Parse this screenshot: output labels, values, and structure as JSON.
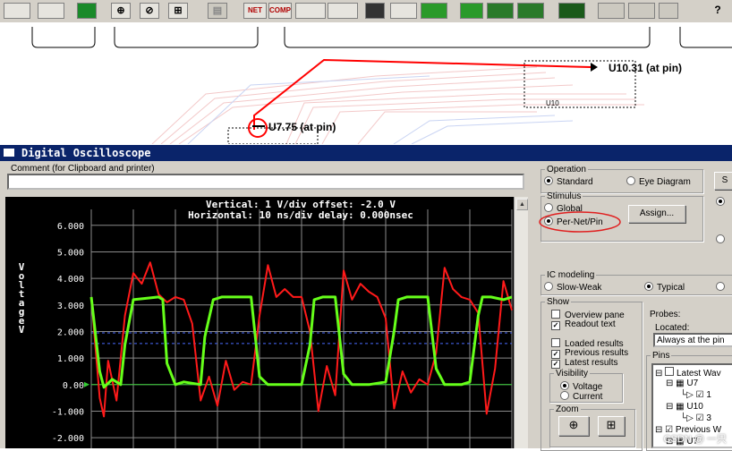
{
  "colors": {
    "trace_red": "#ff1a1a",
    "trace_green": "#66ff1a",
    "titlebar": "#0a246a",
    "scope_bg": "#000000"
  },
  "toolbar": {
    "buttons": [
      {
        "name": "layer-tool-1",
        "label": ""
      },
      {
        "name": "layer-tool-2",
        "label": ""
      },
      {
        "name": "board-tool",
        "label": ""
      },
      {
        "name": "zoom-in-tool",
        "label": "⊕"
      },
      {
        "name": "zoom-out-tool",
        "label": "⊘"
      },
      {
        "name": "zoom-fit-tool",
        "label": "⊞"
      },
      {
        "name": "disabled-tool",
        "label": "▤"
      },
      {
        "name": "net-tool",
        "label": "NET"
      },
      {
        "name": "comp-tool",
        "label": "COMP"
      }
    ],
    "help": "?"
  },
  "pcb": {
    "label_u10_pin": "U10.31 (at pin)",
    "label_u7_pin": "U7.75 (at pin)",
    "label_u10": "U10"
  },
  "window": {
    "title": "Digital Oscilloscope",
    "comment_label": "Comment (for Clipboard and printer)",
    "comment_value": ""
  },
  "scope": {
    "header_line1": "Vertical: 1  V/div  offset: -2.0 V",
    "header_line2": "Horizontal: 10 ns/div  delay: 0.000nsec",
    "y_axis_label": "Voltage V",
    "y_ticks": [
      "6.000",
      "5.000",
      "4.000",
      "3.000",
      "2.000",
      "1.000",
      "0.00",
      "-1.000",
      "-2.000"
    ]
  },
  "chart_data": {
    "type": "line",
    "ylabel": "Voltage V",
    "ylim": [
      -2.4,
      6.6
    ],
    "xlim": [
      0,
      100
    ],
    "series": [
      {
        "name": "",
        "color": "#ff1a1a",
        "x": [
          0,
          2,
          3,
          4,
          6,
          8,
          10,
          12,
          14,
          16,
          18,
          20,
          22,
          24,
          26,
          28,
          30,
          32,
          34,
          36,
          38,
          40,
          42,
          44,
          46,
          48,
          50,
          52,
          54,
          56,
          58,
          60,
          62,
          64,
          66,
          68,
          70,
          72,
          74,
          76,
          78,
          80,
          82,
          84,
          86,
          88,
          90,
          92,
          94,
          96,
          98,
          100
        ],
        "y": [
          3.3,
          -0.5,
          -1.2,
          0.9,
          -0.6,
          2.6,
          4.2,
          3.8,
          4.6,
          3.4,
          3.1,
          3.3,
          3.2,
          2.3,
          -0.6,
          0.3,
          -0.8,
          0.9,
          -0.2,
          0.1,
          0.0,
          2.6,
          4.5,
          3.3,
          3.6,
          3.3,
          3.3,
          2.0,
          -1.0,
          0.7,
          -0.4,
          4.3,
          3.2,
          3.8,
          3.5,
          3.3,
          2.5,
          -0.9,
          0.5,
          -0.3,
          0.2,
          0.0,
          1.2,
          4.4,
          3.6,
          3.3,
          3.2,
          2.7,
          -1.1,
          0.6,
          3.9,
          2.8
        ]
      },
      {
        "name": "",
        "color": "#66ff1a",
        "x": [
          0,
          2,
          3,
          5,
          7,
          8,
          10,
          16,
          17,
          18,
          20,
          22,
          26,
          27,
          29,
          31,
          32,
          38,
          40,
          42,
          46,
          50,
          52,
          53,
          55,
          58,
          60,
          62,
          66,
          70,
          72,
          73,
          75,
          80,
          82,
          84,
          88,
          90,
          92,
          93,
          95,
          98,
          100
        ],
        "y": [
          3.3,
          0.5,
          -0.1,
          0.2,
          0.0,
          1.5,
          3.2,
          3.3,
          3.2,
          0.8,
          0.0,
          0.1,
          0.0,
          1.8,
          3.2,
          3.3,
          3.3,
          3.3,
          0.3,
          0.0,
          0.0,
          0.0,
          1.5,
          3.2,
          3.3,
          3.3,
          0.4,
          0.0,
          0.0,
          0.1,
          2.0,
          3.2,
          3.3,
          3.3,
          0.6,
          0.0,
          0.0,
          0.1,
          2.6,
          3.3,
          3.3,
          3.2,
          3.3
        ]
      }
    ]
  },
  "operation": {
    "legend": "Operation",
    "standard": "Standard",
    "eye": "Eye Diagram",
    "side_btn": "S"
  },
  "stimulus": {
    "legend": "Stimulus",
    "global": "Global",
    "per_net": "Per-Net/Pin",
    "assign": "Assign..."
  },
  "ic_modeling": {
    "legend": "IC modeling",
    "slow": "Slow-Weak",
    "typical": "Typical"
  },
  "show": {
    "legend": "Show",
    "overview": "Overview pane",
    "readout": "Readout text",
    "loaded": "Loaded results",
    "previous": "Previous results",
    "latest": "Latest results",
    "visibility_legend": "Visibility",
    "voltage": "Voltage",
    "current": "Current",
    "zoom_legend": "Zoom"
  },
  "probes": {
    "label": "Probes:",
    "located": "Located:",
    "located_value": "Always at the pin",
    "pins_label": "Pins",
    "tree": [
      "Latest Wav",
      "U7",
      "1",
      "U10",
      "3",
      "Previous W",
      "U7"
    ]
  },
  "watermark": "CSDN @ 一只"
}
